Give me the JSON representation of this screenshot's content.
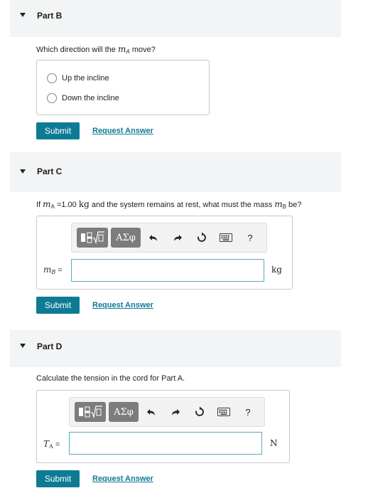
{
  "partB": {
    "title": "Part B",
    "question_prefix": "Which direction will the ",
    "var": "m",
    "var_sub": "A",
    "question_suffix": " move?",
    "options": [
      "Up the incline",
      "Down the incline"
    ],
    "submit_label": "Submit",
    "request_label": "Request Answer"
  },
  "partC": {
    "title": "Part C",
    "q_if": "If ",
    "q_var": "m",
    "q_var_sub": "A",
    "q_eq": " =1.00 ",
    "q_unit": "kg",
    "q_mid": " and the system remains at rest, what must the mass ",
    "q_var2": "m",
    "q_var2_sub": "B",
    "q_end": " be?",
    "input_var": "m",
    "input_var_sub": "B",
    "input_eq": " =",
    "unit": "kg",
    "submit_label": "Submit",
    "request_label": "Request Answer"
  },
  "partD": {
    "title": "Part D",
    "question": "Calculate the tension in the cord for Part A.",
    "input_var": "T",
    "input_var_sub": "A",
    "input_eq": " =",
    "unit": "N",
    "submit_label": "Submit",
    "request_label": "Request Answer"
  },
  "toolbar": {
    "greek_label": "ΑΣφ",
    "help_label": "?"
  }
}
